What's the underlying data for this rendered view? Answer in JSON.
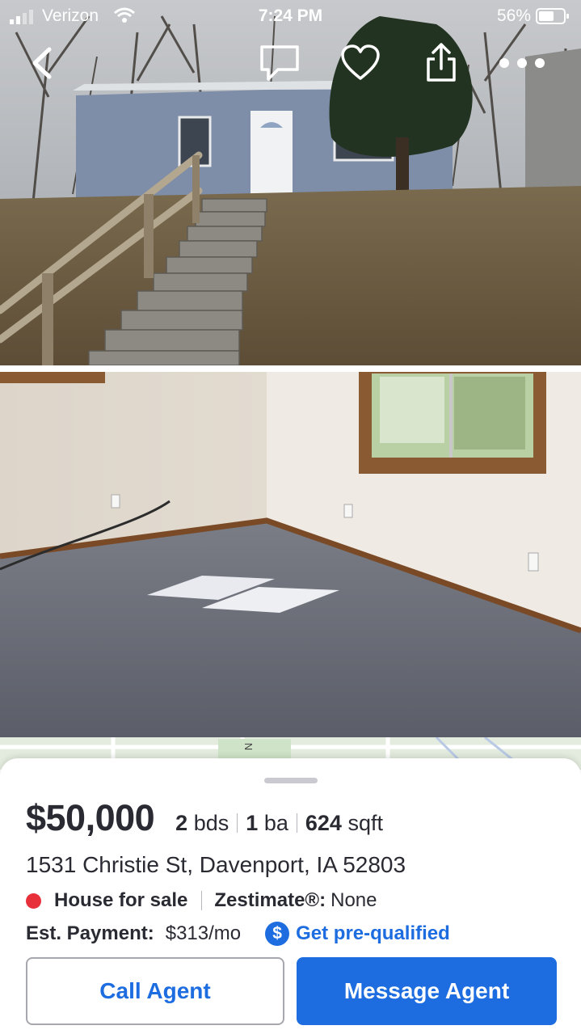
{
  "status_bar": {
    "carrier": "Verizon",
    "time": "7:24 PM",
    "battery": "56%"
  },
  "nav": {
    "icons": [
      "back-chevron-icon",
      "message-bubble-icon",
      "heart-icon",
      "share-icon",
      "more-dots-icon"
    ]
  },
  "photos": [
    {
      "subject": "house-exterior"
    },
    {
      "subject": "interior-bedroom"
    }
  ],
  "map": {
    "compass_letter": "N"
  },
  "listing": {
    "price": "$50,000",
    "beds_value": "2",
    "beds_unit": "bds",
    "baths_value": "1",
    "baths_unit": "ba",
    "sqft_value": "624",
    "sqft_unit": "sqft",
    "address": "1531 Christie St, Davenport, IA 52803",
    "status": "House for sale",
    "status_color": "#e8303b",
    "zestimate_label": "Zestimate®:",
    "zestimate_value": "None",
    "payment_label": "Est. Payment:",
    "payment_value": "$313/mo",
    "prequal_icon": "$",
    "prequal_label": "Get pre-qualified"
  },
  "actions": {
    "call_label": "Call Agent",
    "message_label": "Message Agent"
  },
  "colors": {
    "accent": "#1d6de0",
    "text": "#2a2a33"
  }
}
